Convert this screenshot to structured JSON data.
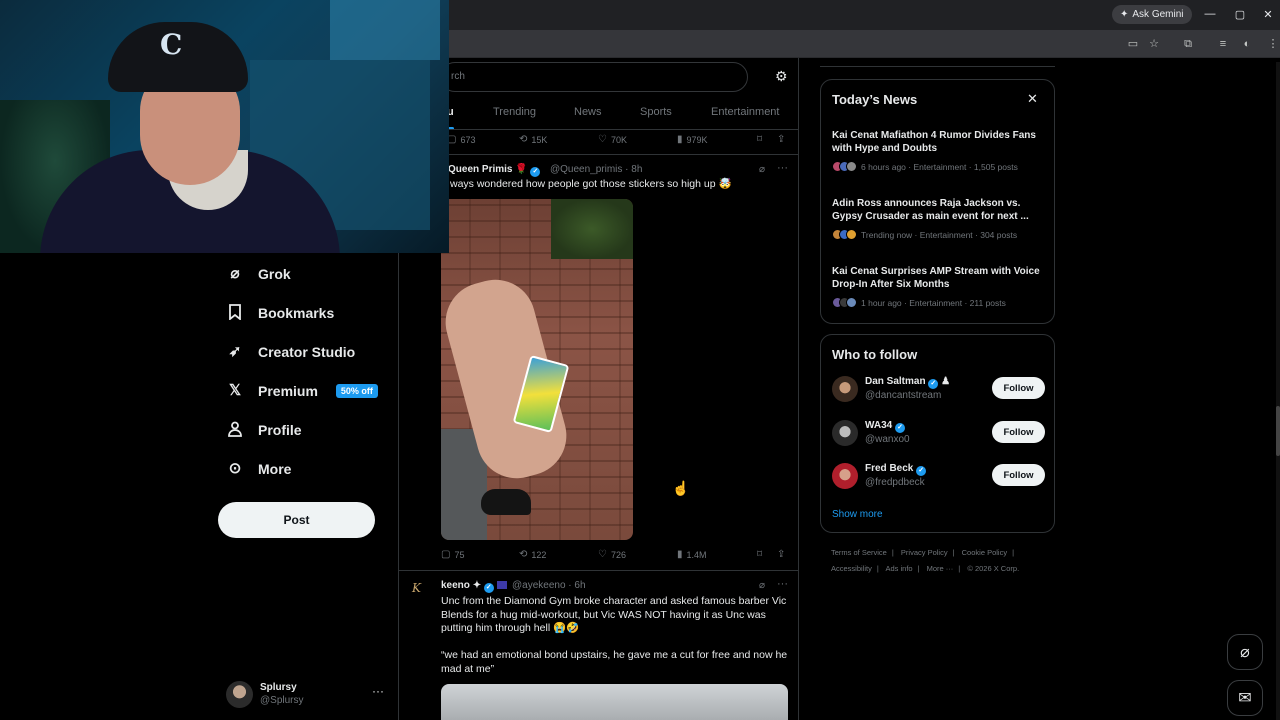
{
  "browser": {
    "gemini_label": "Ask Gemini",
    "window_controls": [
      "—",
      "▢",
      "✕"
    ]
  },
  "nav": {
    "items": [
      {
        "label": "Grok",
        "icon": "grok-icon"
      },
      {
        "label": "Bookmarks",
        "icon": "bookmark-icon"
      },
      {
        "label": "Creator Studio",
        "icon": "rocket-icon"
      },
      {
        "label": "Premium",
        "icon": "x-logo-icon",
        "badge": "50% off"
      },
      {
        "label": "Profile",
        "icon": "person-icon"
      },
      {
        "label": "More",
        "icon": "more-circle-icon"
      }
    ],
    "post_label": "Post",
    "account": {
      "name": "Splursy",
      "handle": "@Splursy"
    }
  },
  "feed": {
    "search_placeholder": "rch",
    "tabs": [
      {
        "label": "u",
        "active": true
      },
      {
        "label": "Trending",
        "active": false
      },
      {
        "label": "News",
        "active": false
      },
      {
        "label": "Sports",
        "active": false
      },
      {
        "label": "Entertainment",
        "active": false
      }
    ],
    "top_actions": {
      "replies": "673",
      "reposts": "15K",
      "likes": "70K",
      "views": "979K"
    },
    "tweet1": {
      "name": "Queen Primis",
      "handle": "@Queen_primis",
      "time": "8h",
      "text": "ways wondered how people got those stickers so high up 🤯",
      "actions": {
        "replies": "75",
        "reposts": "122",
        "likes": "726",
        "views": "1.4M"
      }
    },
    "tweet2": {
      "name": "keeno",
      "handle": "@ayekeeno",
      "time": "6h",
      "text1": "Unc from the Diamond Gym broke character and asked famous barber Vic Blends for a hug mid-workout, but Vic WAS NOT having it as Unc was putting him through hell 😭🤣",
      "text2": "“we had an emotional bond upstairs, he gave me a cut for free and now he mad at me”"
    }
  },
  "news": {
    "title": "Today’s News",
    "items": [
      {
        "title": "Kai Cenat Mafiathon 4 Rumor Divides Fans with Hype and Doubts",
        "meta": "6 hours ago · Entertainment · 1,505 posts"
      },
      {
        "title": "Adin Ross announces Raja Jackson vs. Gypsy Crusader as main event for next ...",
        "meta": "Trending now · Entertainment · 304 posts"
      },
      {
        "title": "Kai Cenat Surprises AMP Stream with Voice Drop-In After Six Months",
        "meta": "1 hour ago · Entertainment · 211 posts"
      }
    ]
  },
  "who_to_follow": {
    "title": "Who to follow",
    "users": [
      {
        "name": "Dan Saltman",
        "handle": "@dancantstream"
      },
      {
        "name": "WA34",
        "handle": "@wanxo0"
      },
      {
        "name": "Fred Beck",
        "handle": "@fredpdbeck"
      }
    ],
    "follow_label": "Follow",
    "show_more": "Show more"
  },
  "footer": {
    "line1": [
      "Terms of Service",
      "Privacy Policy",
      "Cookie Policy"
    ],
    "line2": [
      "Accessibility",
      "Ads info",
      "More ···",
      "© 2026 X Corp."
    ]
  },
  "colors": {
    "accent": "#1d9bf0",
    "background": "#000000",
    "text": "#e7e9ea",
    "muted": "#71767b"
  }
}
